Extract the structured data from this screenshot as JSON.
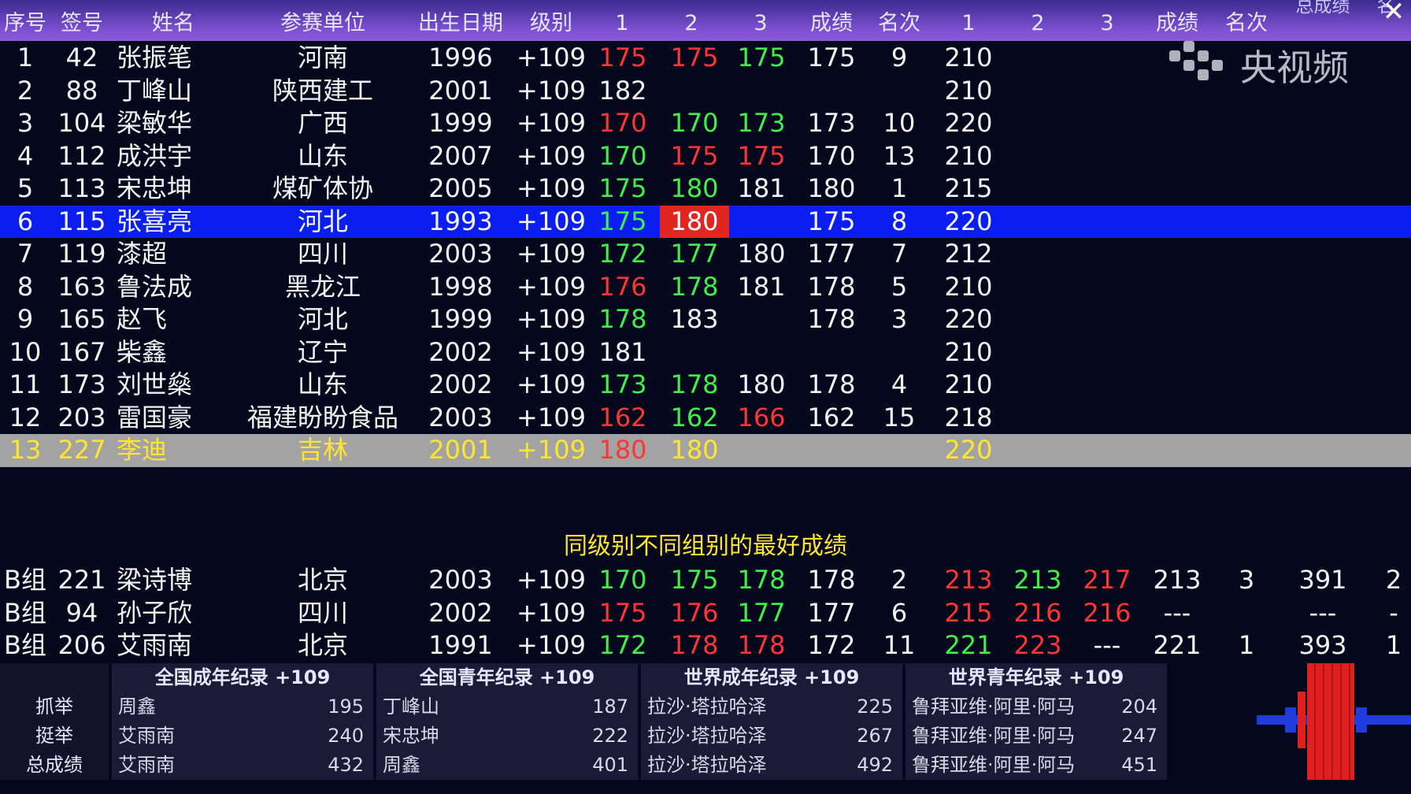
{
  "header": {
    "cols": [
      "序号",
      "签号",
      "姓名",
      "参赛单位",
      "出生日期",
      "级别",
      "1",
      "2",
      "3",
      "成绩",
      "名次",
      "1",
      "2",
      "3",
      "成绩",
      "名次",
      "总成绩",
      "名"
    ],
    "top_right": "总成绩"
  },
  "watermark": {
    "text": "央视频"
  },
  "close_label": "✕",
  "rows": [
    {
      "no": "1",
      "draw": "42",
      "name": "张振笔",
      "unit": "河南",
      "birth": "1996",
      "cls": "+109",
      "s1": "175",
      "s2": "175",
      "s3": "175",
      "best": "175",
      "rank": "9",
      "c1": "210",
      "c1s": "red",
      "c2s": "red",
      "c3s": "green"
    },
    {
      "no": "2",
      "draw": "88",
      "name": "丁峰山",
      "unit": "陕西建工",
      "birth": "2001",
      "cls": "+109",
      "s1": "182",
      "s2": "",
      "s3": "",
      "best": "",
      "rank": "",
      "c1": "210",
      "c1s": "white",
      "c2s": "white",
      "c3s": "white"
    },
    {
      "no": "3",
      "draw": "104",
      "name": "梁敏华",
      "unit": "广西",
      "birth": "1999",
      "cls": "+109",
      "s1": "170",
      "s2": "170",
      "s3": "173",
      "best": "173",
      "rank": "10",
      "c1": "220",
      "c1s": "red",
      "c2s": "green",
      "c3s": "green"
    },
    {
      "no": "4",
      "draw": "112",
      "name": "成洪宇",
      "unit": "山东",
      "birth": "2007",
      "cls": "+109",
      "s1": "170",
      "s2": "175",
      "s3": "175",
      "best": "170",
      "rank": "13",
      "c1": "210",
      "c1s": "green",
      "c2s": "red",
      "c3s": "red"
    },
    {
      "no": "5",
      "draw": "113",
      "name": "宋忠坤",
      "unit": "煤矿体协",
      "birth": "2005",
      "cls": "+109",
      "s1": "175",
      "s2": "180",
      "s3": "181",
      "best": "180",
      "rank": "1",
      "c1": "215",
      "c1s": "green",
      "c2s": "green",
      "c3s": "white"
    },
    {
      "no": "6",
      "draw": "115",
      "name": "张喜亮",
      "unit": "河北",
      "birth": "1993",
      "cls": "+109",
      "s1": "175",
      "s2": "180",
      "s3": "",
      "best": "175",
      "rank": "8",
      "c1": "220",
      "c1s": "green",
      "c2s": "redbox",
      "c3s": "white",
      "hl": "blue"
    },
    {
      "no": "7",
      "draw": "119",
      "name": "漆超",
      "unit": "四川",
      "birth": "2003",
      "cls": "+109",
      "s1": "172",
      "s2": "177",
      "s3": "180",
      "best": "177",
      "rank": "7",
      "c1": "212",
      "c1s": "green",
      "c2s": "green",
      "c3s": "white"
    },
    {
      "no": "8",
      "draw": "163",
      "name": "鲁法成",
      "unit": "黑龙江",
      "birth": "1998",
      "cls": "+109",
      "s1": "176",
      "s2": "178",
      "s3": "181",
      "best": "178",
      "rank": "5",
      "c1": "210",
      "c1s": "red",
      "c2s": "green",
      "c3s": "white"
    },
    {
      "no": "9",
      "draw": "165",
      "name": "赵飞",
      "unit": "河北",
      "birth": "1999",
      "cls": "+109",
      "s1": "178",
      "s2": "183",
      "s3": "",
      "best": "178",
      "rank": "3",
      "c1": "220",
      "c1s": "green",
      "c2s": "white",
      "c3s": "white"
    },
    {
      "no": "10",
      "draw": "167",
      "name": "柴鑫",
      "unit": "辽宁",
      "birth": "2002",
      "cls": "+109",
      "s1": "181",
      "s2": "",
      "s3": "",
      "best": "",
      "rank": "",
      "c1": "210",
      "c1s": "white",
      "c2s": "white",
      "c3s": "white"
    },
    {
      "no": "11",
      "draw": "173",
      "name": "刘世燊",
      "unit": "山东",
      "birth": "2002",
      "cls": "+109",
      "s1": "173",
      "s2": "178",
      "s3": "180",
      "best": "178",
      "rank": "4",
      "c1": "210",
      "c1s": "green",
      "c2s": "green",
      "c3s": "white"
    },
    {
      "no": "12",
      "draw": "203",
      "name": "雷国豪",
      "unit": "福建盼盼食品",
      "birth": "2003",
      "cls": "+109",
      "s1": "162",
      "s2": "162",
      "s3": "166",
      "best": "162",
      "rank": "15",
      "c1": "218",
      "c1s": "red",
      "c2s": "green",
      "c3s": "red"
    },
    {
      "no": "13",
      "draw": "227",
      "name": "李迪",
      "unit": "吉林",
      "birth": "2001",
      "cls": "+109",
      "s1": "180",
      "s2": "180",
      "s3": "",
      "best": "",
      "rank": "",
      "c1": "220",
      "c1s": "red",
      "c2s": "yellow",
      "c3s": "yellow",
      "hl": "grey"
    }
  ],
  "section_title": "同级别不同组别的最好成绩",
  "group_rows": [
    {
      "grp": "B组",
      "draw": "221",
      "name": "梁诗博",
      "unit": "北京",
      "birth": "2003",
      "cls": "+109",
      "s1": "170",
      "s2": "175",
      "s3": "178",
      "best": "178",
      "rank": "2",
      "cj1": "213",
      "cj2": "213",
      "cj3": "217",
      "cjbest": "213",
      "cjrank": "3",
      "total": "391",
      "trank": "2",
      "cs": [
        "green",
        "green",
        "green"
      ],
      "cjs": [
        "red",
        "green",
        "red"
      ]
    },
    {
      "grp": "B组",
      "draw": "94",
      "name": "孙子欣",
      "unit": "四川",
      "birth": "2002",
      "cls": "+109",
      "s1": "175",
      "s2": "176",
      "s3": "177",
      "best": "177",
      "rank": "6",
      "cj1": "215",
      "cj2": "216",
      "cj3": "216",
      "cjbest": "---",
      "cjrank": "",
      "total": "---",
      "trank": "-",
      "cs": [
        "red",
        "red",
        "green"
      ],
      "cjs": [
        "red",
        "red",
        "red"
      ]
    },
    {
      "grp": "B组",
      "draw": "206",
      "name": "艾雨南",
      "unit": "北京",
      "birth": "1991",
      "cls": "+109",
      "s1": "172",
      "s2": "178",
      "s3": "178",
      "best": "172",
      "rank": "11",
      "cj1": "221",
      "cj2": "223",
      "cj3": "---",
      "cjbest": "221",
      "cjrank": "1",
      "total": "393",
      "trank": "1",
      "cs": [
        "green",
        "red",
        "red"
      ],
      "cjs": [
        "green",
        "red",
        "white"
      ]
    }
  ],
  "records": {
    "labels": [
      "抓举",
      "挺举",
      "总成绩"
    ],
    "blocks": [
      {
        "title": "全国成年纪录  +109",
        "rows": [
          {
            "name": "周鑫",
            "val": "195"
          },
          {
            "name": "艾雨南",
            "val": "240"
          },
          {
            "name": "艾雨南",
            "val": "432"
          }
        ]
      },
      {
        "title": "全国青年纪录  +109",
        "rows": [
          {
            "name": "丁峰山",
            "val": "187"
          },
          {
            "name": "宋忠坤",
            "val": "222"
          },
          {
            "name": "周鑫",
            "val": "401"
          }
        ]
      },
      {
        "title": "世界成年纪录  +109",
        "rows": [
          {
            "name": "拉沙·塔拉哈泽",
            "val": "225"
          },
          {
            "name": "拉沙·塔拉哈泽",
            "val": "267"
          },
          {
            "name": "拉沙·塔拉哈泽",
            "val": "492"
          }
        ]
      },
      {
        "title": "世界青年纪录  +109",
        "rows": [
          {
            "name": "鲁拜亚维·阿里·阿马",
            "val": "204"
          },
          {
            "name": "鲁拜亚维·阿里·阿马",
            "val": "247"
          },
          {
            "name": "鲁拜亚维·阿里·阿马",
            "val": "451"
          }
        ]
      }
    ]
  },
  "colors": {
    "green": "#3ff04a",
    "red": "#ff3535",
    "yellow": "#ffe530",
    "blue_highlight": "#0a1ef0",
    "grey_highlight": "#a3a3a3",
    "header": "#7b4fcf"
  }
}
